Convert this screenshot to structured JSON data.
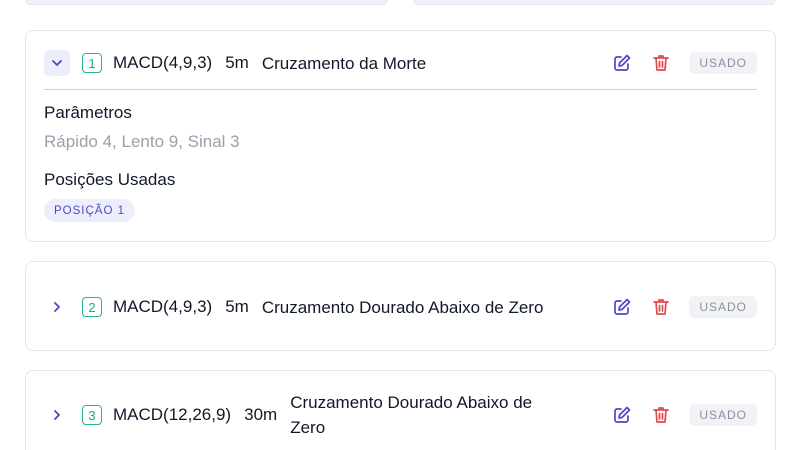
{
  "colors": {
    "accent": "#4f46c8",
    "number_badge": "#22b58a",
    "delete": "#e5484d",
    "muted": "#9aa0ab"
  },
  "strategies": [
    {
      "number": "1",
      "indicator": "MACD(4,9,3)",
      "timeframe": "5m",
      "signal": "Cruzamento da Morte",
      "status": "USADO",
      "expanded": true,
      "parameters_title": "Parâmetros",
      "parameters_value": "Rápido 4, Lento 9, Sinal 3",
      "positions_title": "Posições Usadas",
      "positions": [
        "POSIÇÃO 1"
      ],
      "icons": {
        "toggle": "chevron-down-icon",
        "edit": "edit-icon",
        "delete": "trash-icon"
      }
    },
    {
      "number": "2",
      "indicator": "MACD(4,9,3)",
      "timeframe": "5m",
      "signal": "Cruzamento Dourado Abaixo de Zero",
      "status": "USADO",
      "expanded": false,
      "icons": {
        "toggle": "chevron-right-icon",
        "edit": "edit-icon",
        "delete": "trash-icon"
      }
    },
    {
      "number": "3",
      "indicator": "MACD(12,26,9)",
      "timeframe": "30m",
      "signal": "Cruzamento Dourado Abaixo de Zero",
      "status": "USADO",
      "expanded": false,
      "icons": {
        "toggle": "chevron-right-icon",
        "edit": "edit-icon",
        "delete": "trash-icon"
      }
    }
  ]
}
